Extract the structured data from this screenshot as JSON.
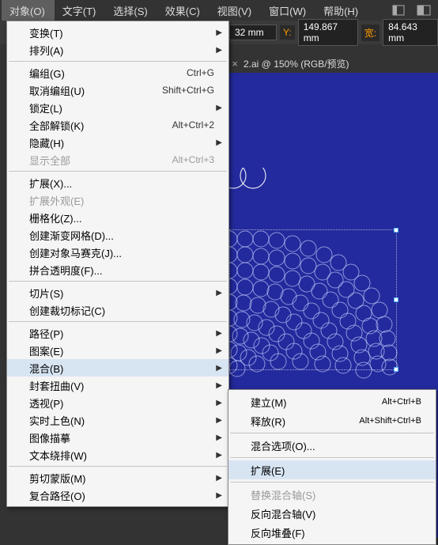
{
  "menubar": {
    "items": [
      {
        "label": "对象(O)",
        "active": true
      },
      {
        "label": "文字(T)",
        "active": false
      },
      {
        "label": "选择(S)",
        "active": false
      },
      {
        "label": "效果(C)",
        "active": false
      },
      {
        "label": "视图(V)",
        "active": false
      },
      {
        "label": "窗口(W)",
        "active": false
      },
      {
        "label": "帮助(H)",
        "active": false
      }
    ]
  },
  "optbar": {
    "x_suffix": "32 mm",
    "y_label": "Y:",
    "y_value": "149.867",
    "w_label": "宽:",
    "w_value": "84.643",
    "unit": "mm"
  },
  "tabbar": {
    "close": "×",
    "name": "2.ai @ 150% (RGB/预览)"
  },
  "menu": {
    "transform": "变换(T)",
    "arrange": "排列(A)",
    "group": "编组(G)",
    "group_sc": "Ctrl+G",
    "ungroup": "取消编组(U)",
    "ungroup_sc": "Shift+Ctrl+G",
    "lock": "锁定(L)",
    "unlock_all": "全部解锁(K)",
    "unlock_all_sc": "Alt+Ctrl+2",
    "hide": "隐藏(H)",
    "show_all": "显示全部",
    "show_all_sc": "Alt+Ctrl+3",
    "expand": "扩展(X)...",
    "expand_appearance": "扩展外观(E)",
    "rasterize": "栅格化(Z)...",
    "gradient_mesh": "创建渐变网格(D)...",
    "object_mosaic": "创建对象马赛克(J)...",
    "flatten": "拼合透明度(F)...",
    "slice": "切片(S)",
    "trim_marks": "创建裁切标记(C)",
    "path": "路径(P)",
    "pattern": "图案(E)",
    "blend": "混合(B)",
    "envelope": "封套扭曲(V)",
    "perspective": "透视(P)",
    "live_paint": "实时上色(N)",
    "image_trace": "图像描摹",
    "text_wrap": "文本绕排(W)",
    "clipping_mask": "剪切蒙版(M)",
    "compound_path": "复合路径(O)"
  },
  "submenu": {
    "make": "建立(M)",
    "make_sc": "Alt+Ctrl+B",
    "release": "释放(R)",
    "release_sc": "Alt+Shift+Ctrl+B",
    "options": "混合选项(O)...",
    "expand": "扩展(E)",
    "replace_spine": "替换混合轴(S)",
    "reverse_spine": "反向混合轴(V)",
    "reverse_front": "反向堆叠(F)"
  }
}
